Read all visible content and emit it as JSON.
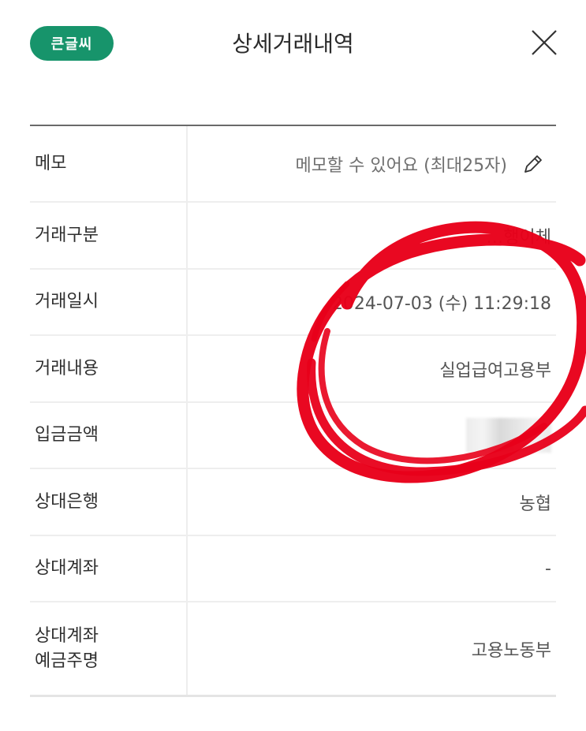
{
  "header": {
    "big_font_label": "큰글씨",
    "title": "상세거래내역",
    "close_icon": "close-icon"
  },
  "memo": {
    "label": "메모",
    "placeholder": "메모할 수 있어요 (최대25자)",
    "edit_icon": "pencil-icon"
  },
  "rows": {
    "type": {
      "label": "거래구분",
      "value": "…행이체"
    },
    "datetime": {
      "label": "거래일시",
      "value": "2024-07-03 (수) 11:29:18"
    },
    "content": {
      "label": "거래내용",
      "value": "실업급여고용부"
    },
    "amount": {
      "label": "입금금액",
      "value": ""
    },
    "bank": {
      "label": "상대은행",
      "value": "농협"
    },
    "account": {
      "label": "상대계좌",
      "value": "-"
    },
    "holder": {
      "label_line1": "상대계좌",
      "label_line2": "예금주명",
      "value": "고용노동부"
    }
  },
  "colors": {
    "accent": "#17946b",
    "annotation": "#e8001a"
  }
}
